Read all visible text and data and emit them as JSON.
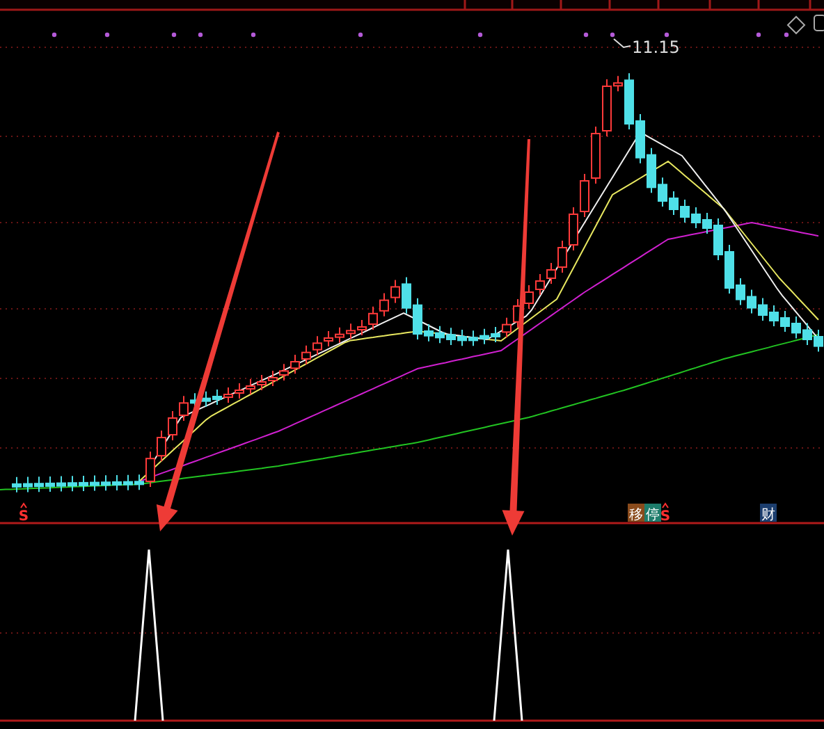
{
  "chart": {
    "price_label": "11.15",
    "markers": [
      {
        "text": "S",
        "kind": "signal"
      },
      {
        "text": "移",
        "kind": "tag",
        "color": "#8a4b1c"
      },
      {
        "text": "停",
        "kind": "tag",
        "color": "#1e7d6c"
      },
      {
        "text": "S",
        "kind": "signal"
      },
      {
        "text": "财",
        "kind": "tag",
        "color": "#1c3e6e"
      }
    ]
  }
}
